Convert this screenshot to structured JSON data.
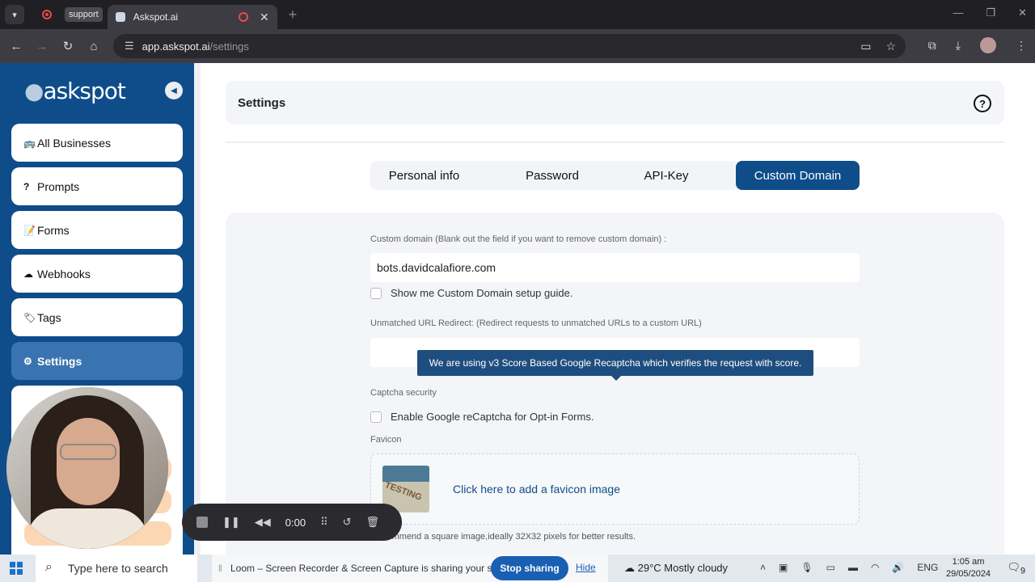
{
  "browser": {
    "pinned_tab": "support",
    "tab_title": "Askspot.ai",
    "url_host": "app.askspot.ai",
    "url_path": "/settings"
  },
  "sidebar": {
    "logo": "askspot",
    "items": [
      {
        "label": "All Businesses",
        "icon": "🚌"
      },
      {
        "label": "Prompts",
        "icon": "?"
      },
      {
        "label": "Forms",
        "icon": "📝"
      },
      {
        "label": "Webhooks",
        "icon": "☁"
      },
      {
        "label": "Tags",
        "icon": "🏷"
      },
      {
        "label": "Settings",
        "icon": "⚙"
      }
    ]
  },
  "page": {
    "title": "Settings",
    "tabs": [
      "Personal info",
      "Password",
      "API-Key",
      "Custom Domain"
    ],
    "active_tab": "Custom Domain"
  },
  "form": {
    "custom_domain_label": "Custom domain (Blank out the field if you want to remove custom domain) :",
    "custom_domain_value": "bots.davidcalafiore.com",
    "setup_guide_label": "Show me Custom Domain setup guide.",
    "redirect_label": "Unmatched URL Redirect: (Redirect requests to unmatched URLs to a custom URL)",
    "redirect_value": "",
    "tooltip": "We are using v3 Score Based Google Recaptcha which verifies the request with score.",
    "captcha_label": "Captcha security",
    "recaptcha_label": "Enable Google reCaptcha for Opt-in Forms.",
    "favicon_label": "Favicon",
    "favicon_thumb_text": "TESTING",
    "favicon_upload": "Click here to add a favicon image",
    "favicon_hint": "commend a square image,ideally 32X32 pixels for better results."
  },
  "loom": {
    "time": "0:00",
    "share_text": "Loom – Screen Recorder & Screen Capture is sharing your screen.",
    "stop_sharing": "Stop sharing",
    "hide": "Hide"
  },
  "taskbar": {
    "search_placeholder": "Type here to search",
    "weather": "29°C  Mostly cloudy",
    "language": "ENG",
    "time": "1:05 am",
    "date": "29/05/2024",
    "notification_count": "9"
  }
}
